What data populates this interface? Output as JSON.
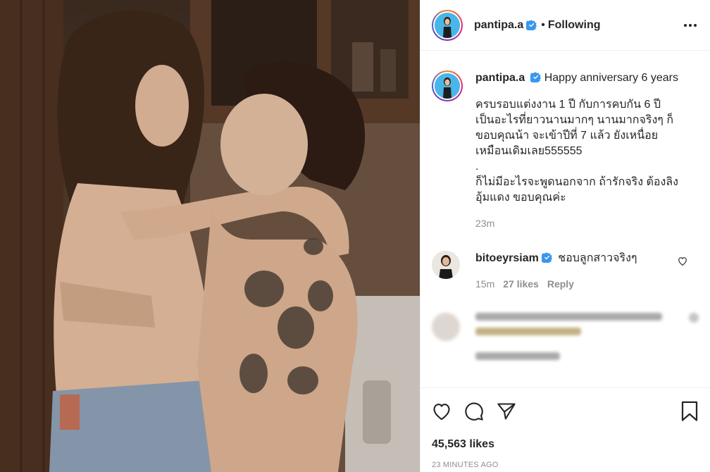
{
  "header": {
    "username": "pantipa.a",
    "separator": "•",
    "follow_status": "Following",
    "more_icon": "more-dots-icon"
  },
  "caption": {
    "username": "pantipa.a",
    "title_text": "Happy anniversary 6 years",
    "paragraph_1": "ครบรอบแต่งงาน 1 ปี กับการคบกัน 6 ปี\nเป็นอะไรที่ยาวนานมากๆ นานมากจริงๆ ก็\nขอบคุณน้า จะเข้าปีที่ 7 แล้ว ยังเหนื่อย\nเหมือนเดิมเลย555555",
    "paragraph_dot": ".",
    "paragraph_2": "ก็ไม่มีอะไรจะพูดนอกจาก ถ้ารักจริง ต้องลิง\nอุ้มแดง ขอบคุณค่ะ",
    "time_ago": "23m"
  },
  "comments": [
    {
      "username": "bitoeyrsiam",
      "text": "ชอบลูกสาวจริงๆ",
      "time_ago": "15m",
      "likes": "27 likes",
      "reply": "Reply"
    }
  ],
  "actions": {
    "likes_count": "45,563 likes",
    "timestamp": "23 MINUTES AGO"
  },
  "colors": {
    "verified_blue": "#3897f0",
    "text": "#262626",
    "muted": "#8e8e8e",
    "border": "#efefef"
  }
}
